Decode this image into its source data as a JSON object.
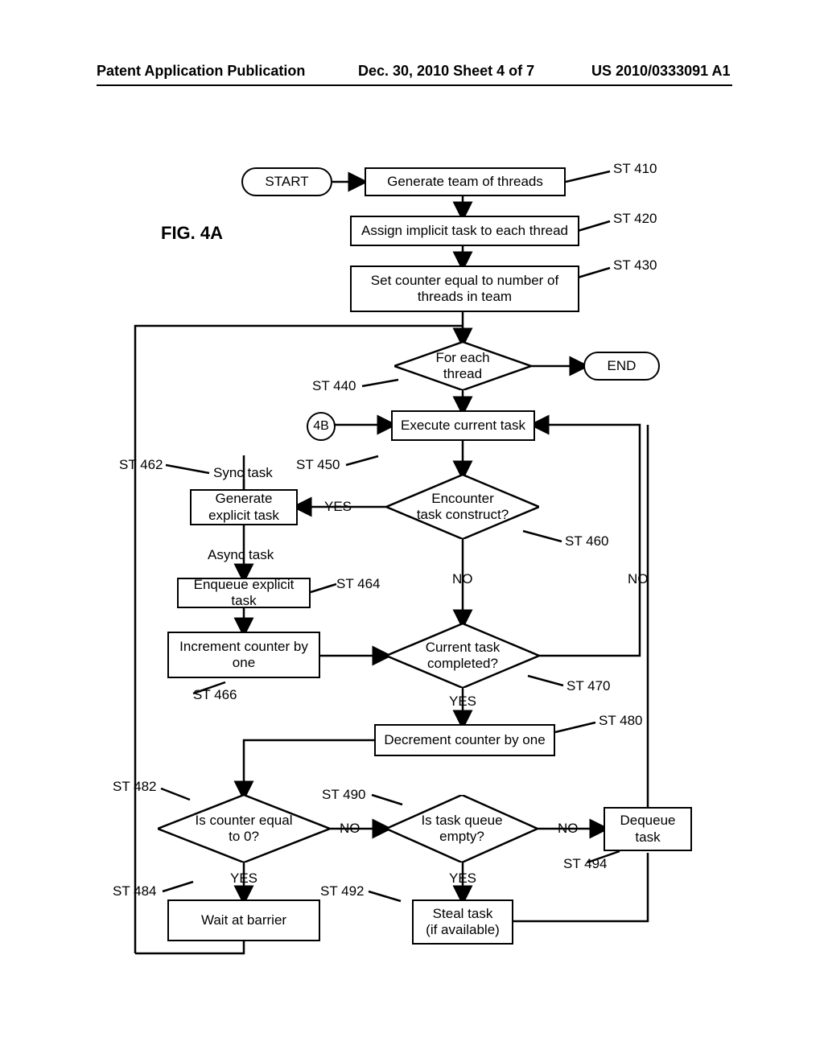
{
  "header": {
    "left": "Patent Application Publication",
    "center": "Dec. 30, 2010  Sheet 4 of 7",
    "right": "US 2010/0333091 A1"
  },
  "figure_label": "FIG. 4A",
  "terminals": {
    "start": "START",
    "end": "END"
  },
  "connector": "4B",
  "steps": {
    "st410": "Generate team of threads",
    "st420": "Assign implicit task to each thread",
    "st430": "Set counter equal to number of\nthreads in team",
    "st440": "For each\nthread",
    "st450": "Execute current task",
    "st460": "Encounter\ntask construct?",
    "st462": "Generate\nexplicit task",
    "st464": "Enqueue explicit task",
    "st466": "Increment counter by\none",
    "st470": "Current task\ncompleted?",
    "st480": "Decrement counter by one",
    "st482": "Is counter equal\nto 0?",
    "st484": "Wait at barrier",
    "st490": "Is task queue\nempty?",
    "st492": "Steal task\n(if available)",
    "st494": "Dequeue\ntask"
  },
  "labels": {
    "st410": "ST 410",
    "st420": "ST 420",
    "st430": "ST 430",
    "st440": "ST 440",
    "st450": "ST 450",
    "st460": "ST 460",
    "st462": "ST 462",
    "st464": "ST 464",
    "st466": "ST 466",
    "st470": "ST 470",
    "st480": "ST 480",
    "st482": "ST 482",
    "st484": "ST 484",
    "st490": "ST 490",
    "st492": "ST 492",
    "st494": "ST 494",
    "sync": "Sync task",
    "async": "Async task",
    "yes": "YES",
    "no": "NO"
  }
}
